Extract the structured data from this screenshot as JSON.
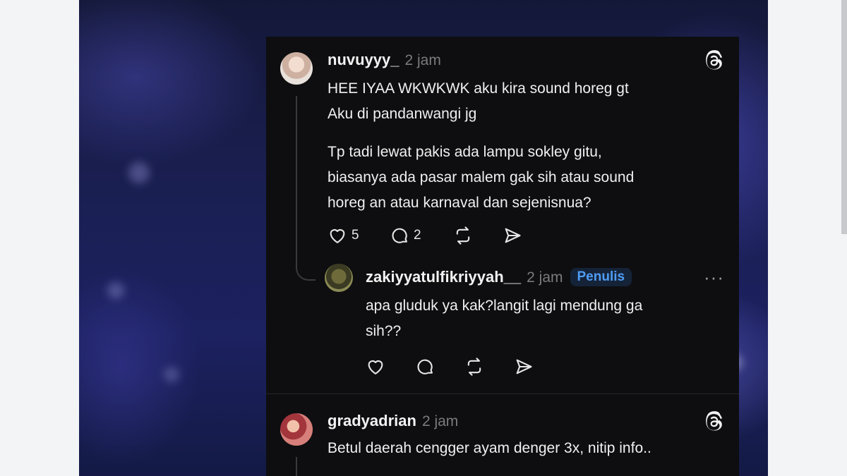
{
  "posts": [
    {
      "username": "nuvuyyy_",
      "time": "2 jam",
      "lines": [
        "HEE IYAA WKWKWK aku kira sound horeg gt",
        "Aku di pandanwangi jg",
        "",
        "Tp tadi lewat pakis ada lampu sokley gitu,",
        "biasanya ada pasar malem gak sih atau sound",
        "horeg an atau karnaval dan sejenisnua?"
      ],
      "likes": "5",
      "replies": "2"
    },
    {
      "username": "zakiyyatulfikriyyah__",
      "time": "2 jam",
      "badge": "Penulis",
      "more": "···",
      "lines": [
        "apa gluduk ya kak?langit lagi mendung ga",
        "sih??"
      ]
    },
    {
      "username": "gradyadrian",
      "time": "2 jam",
      "lines": [
        "Betul daerah cengger ayam denger 3x, nitip info.."
      ]
    }
  ],
  "icons": {
    "threads": "threads-logo-icon",
    "like": "heart-icon",
    "reply": "comment-icon",
    "repost": "repost-icon",
    "share": "send-icon"
  },
  "colors": {
    "card_bg": "#0e0e10",
    "badge_text": "#4e9cf5",
    "muted": "#7b7b80"
  }
}
